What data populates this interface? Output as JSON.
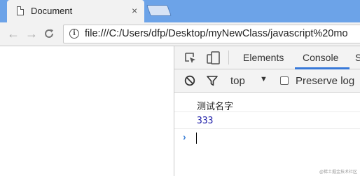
{
  "tab": {
    "title": "Document",
    "close": "×"
  },
  "toolbar": {
    "back": "←",
    "forward": "→",
    "reload": "C",
    "url": "file:///C:/Users/dfp/Desktop/myNewClass/javascript%20mo"
  },
  "devtools": {
    "tabs": [
      "Elements",
      "Console",
      "S"
    ],
    "active_tab": "Console",
    "context": "top",
    "context_arrow": "▼",
    "preserve_log": "Preserve log",
    "console": {
      "log_line": "测试名字",
      "result_line": "333",
      "prompt": "›"
    }
  },
  "watermark": "@稀土掘金技术社区"
}
